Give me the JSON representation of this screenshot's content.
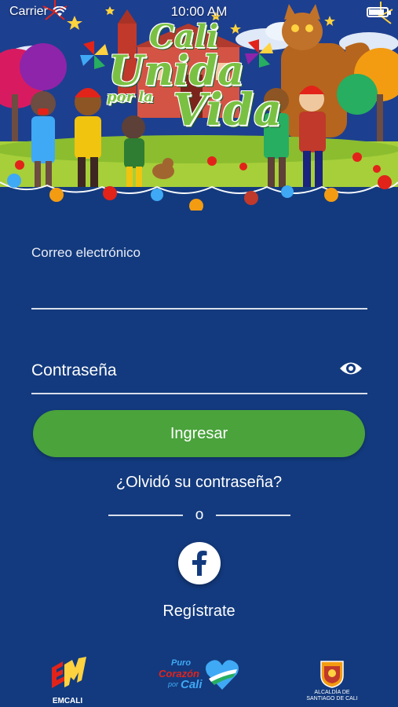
{
  "status_bar": {
    "carrier": "Carrier",
    "time": "10:00 AM"
  },
  "hero": {
    "title_line1": "Cali",
    "title_line2": "Unida",
    "title_line3": "por la",
    "title_line4": "Vida"
  },
  "form": {
    "email_label": "Correo electrónico",
    "email_value": "",
    "password_placeholder": "Contraseña",
    "password_value": "",
    "login_label": "Ingresar",
    "forgot_label": "¿Olvidó su contraseña?",
    "divider_text": "o",
    "register_label": "Regístrate"
  },
  "footer": {
    "emcali_label": "EMCALI",
    "corazon_line1": "Puro",
    "corazon_line2": "Corazón",
    "corazon_line3": "por",
    "corazon_line4": "Cali",
    "alcaldia_label": "ALCALDÍA DE SANTIAGO DE CALI"
  },
  "icons": {
    "wifi": "wifi-icon",
    "battery": "battery-icon",
    "eye": "eye-icon",
    "facebook": "facebook-icon"
  },
  "colors": {
    "background": "#133a7e",
    "primary_button": "#4aa33b",
    "title_green": "#7ac143",
    "hero_grass": "#a6cf3a"
  }
}
